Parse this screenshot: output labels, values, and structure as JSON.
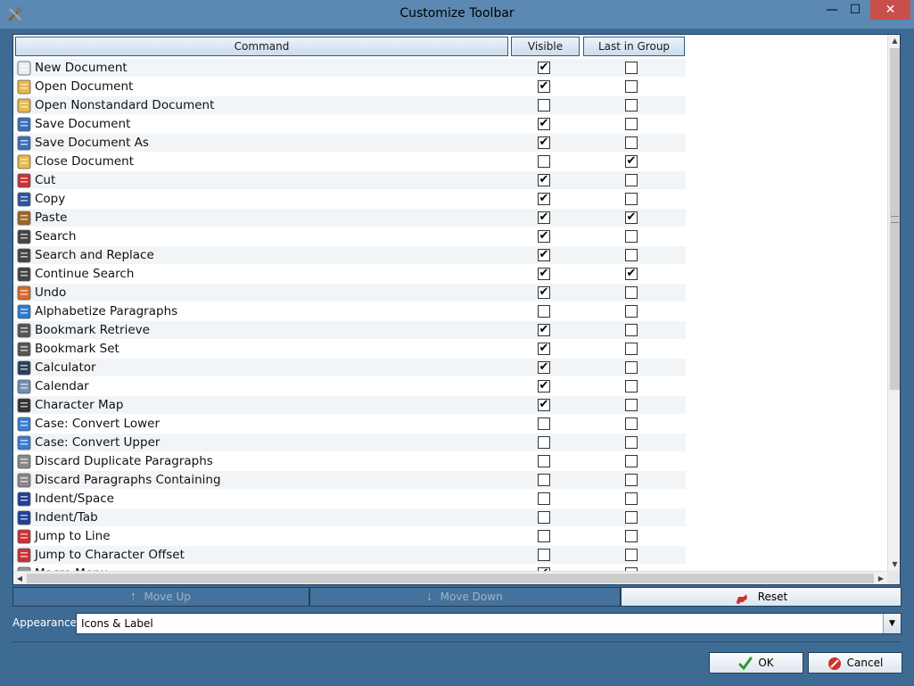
{
  "window": {
    "title": "Customize Toolbar",
    "min_glyph": "—",
    "max_glyph": "☐",
    "close_glyph": "✕"
  },
  "grid": {
    "headers": {
      "command": "Command",
      "visible": "Visible",
      "last_in_group": "Last in Group"
    },
    "rows": [
      {
        "label": "New Document",
        "icon": "new-document-icon",
        "visible": true,
        "last": false
      },
      {
        "label": "Open Document",
        "icon": "open-document-icon",
        "visible": true,
        "last": false
      },
      {
        "label": "Open Nonstandard Document",
        "icon": "open-nonstandard-document-icon",
        "visible": false,
        "last": false
      },
      {
        "label": "Save Document",
        "icon": "save-document-icon",
        "visible": true,
        "last": false
      },
      {
        "label": "Save Document As",
        "icon": "save-document-as-icon",
        "visible": true,
        "last": false
      },
      {
        "label": "Close Document",
        "icon": "close-document-icon",
        "visible": false,
        "last": true
      },
      {
        "label": "Cut",
        "icon": "cut-icon",
        "visible": true,
        "last": false
      },
      {
        "label": "Copy",
        "icon": "copy-icon",
        "visible": true,
        "last": false
      },
      {
        "label": "Paste",
        "icon": "paste-icon",
        "visible": true,
        "last": true
      },
      {
        "label": "Search",
        "icon": "search-icon",
        "visible": true,
        "last": false
      },
      {
        "label": "Search and Replace",
        "icon": "search-replace-icon",
        "visible": true,
        "last": false
      },
      {
        "label": "Continue Search",
        "icon": "continue-search-icon",
        "visible": true,
        "last": true
      },
      {
        "label": "Undo",
        "icon": "undo-icon",
        "visible": true,
        "last": false
      },
      {
        "label": "Alphabetize Paragraphs",
        "icon": "alphabetize-icon",
        "visible": false,
        "last": false
      },
      {
        "label": "Bookmark Retrieve",
        "icon": "bookmark-retrieve-icon",
        "visible": true,
        "last": false
      },
      {
        "label": "Bookmark Set",
        "icon": "bookmark-set-icon",
        "visible": true,
        "last": false
      },
      {
        "label": "Calculator",
        "icon": "calculator-icon",
        "visible": true,
        "last": false
      },
      {
        "label": "Calendar",
        "icon": "calendar-icon",
        "visible": true,
        "last": false
      },
      {
        "label": "Character Map",
        "icon": "character-map-icon",
        "visible": true,
        "last": false
      },
      {
        "label": "Case: Convert Lower",
        "icon": "case-lower-icon",
        "visible": false,
        "last": false
      },
      {
        "label": "Case: Convert Upper",
        "icon": "case-upper-icon",
        "visible": false,
        "last": false
      },
      {
        "label": "Discard Duplicate Paragraphs",
        "icon": "discard-duplicate-icon",
        "visible": false,
        "last": false
      },
      {
        "label": "Discard Paragraphs Containing",
        "icon": "discard-containing-icon",
        "visible": false,
        "last": false
      },
      {
        "label": "Indent/Space",
        "icon": "indent-space-icon",
        "visible": false,
        "last": false
      },
      {
        "label": "Indent/Tab",
        "icon": "indent-tab-icon",
        "visible": false,
        "last": false
      },
      {
        "label": "Jump to Line",
        "icon": "jump-line-icon",
        "visible": false,
        "last": false
      },
      {
        "label": "Jump to Character Offset",
        "icon": "jump-offset-icon",
        "visible": false,
        "last": false
      },
      {
        "label": "Macro Menu",
        "icon": "macro-menu-icon",
        "visible": true,
        "last": false
      }
    ]
  },
  "actions": {
    "move_up": "Move Up",
    "move_down": "Move Down",
    "reset": "Reset"
  },
  "appearance": {
    "label": "Appearance:",
    "value": "Icons & Label"
  },
  "dialog": {
    "ok": "OK",
    "cancel": "Cancel"
  },
  "colors": {
    "background": "#3e6b94",
    "titlebar": "#5c89b3",
    "close": "#c7504c"
  }
}
